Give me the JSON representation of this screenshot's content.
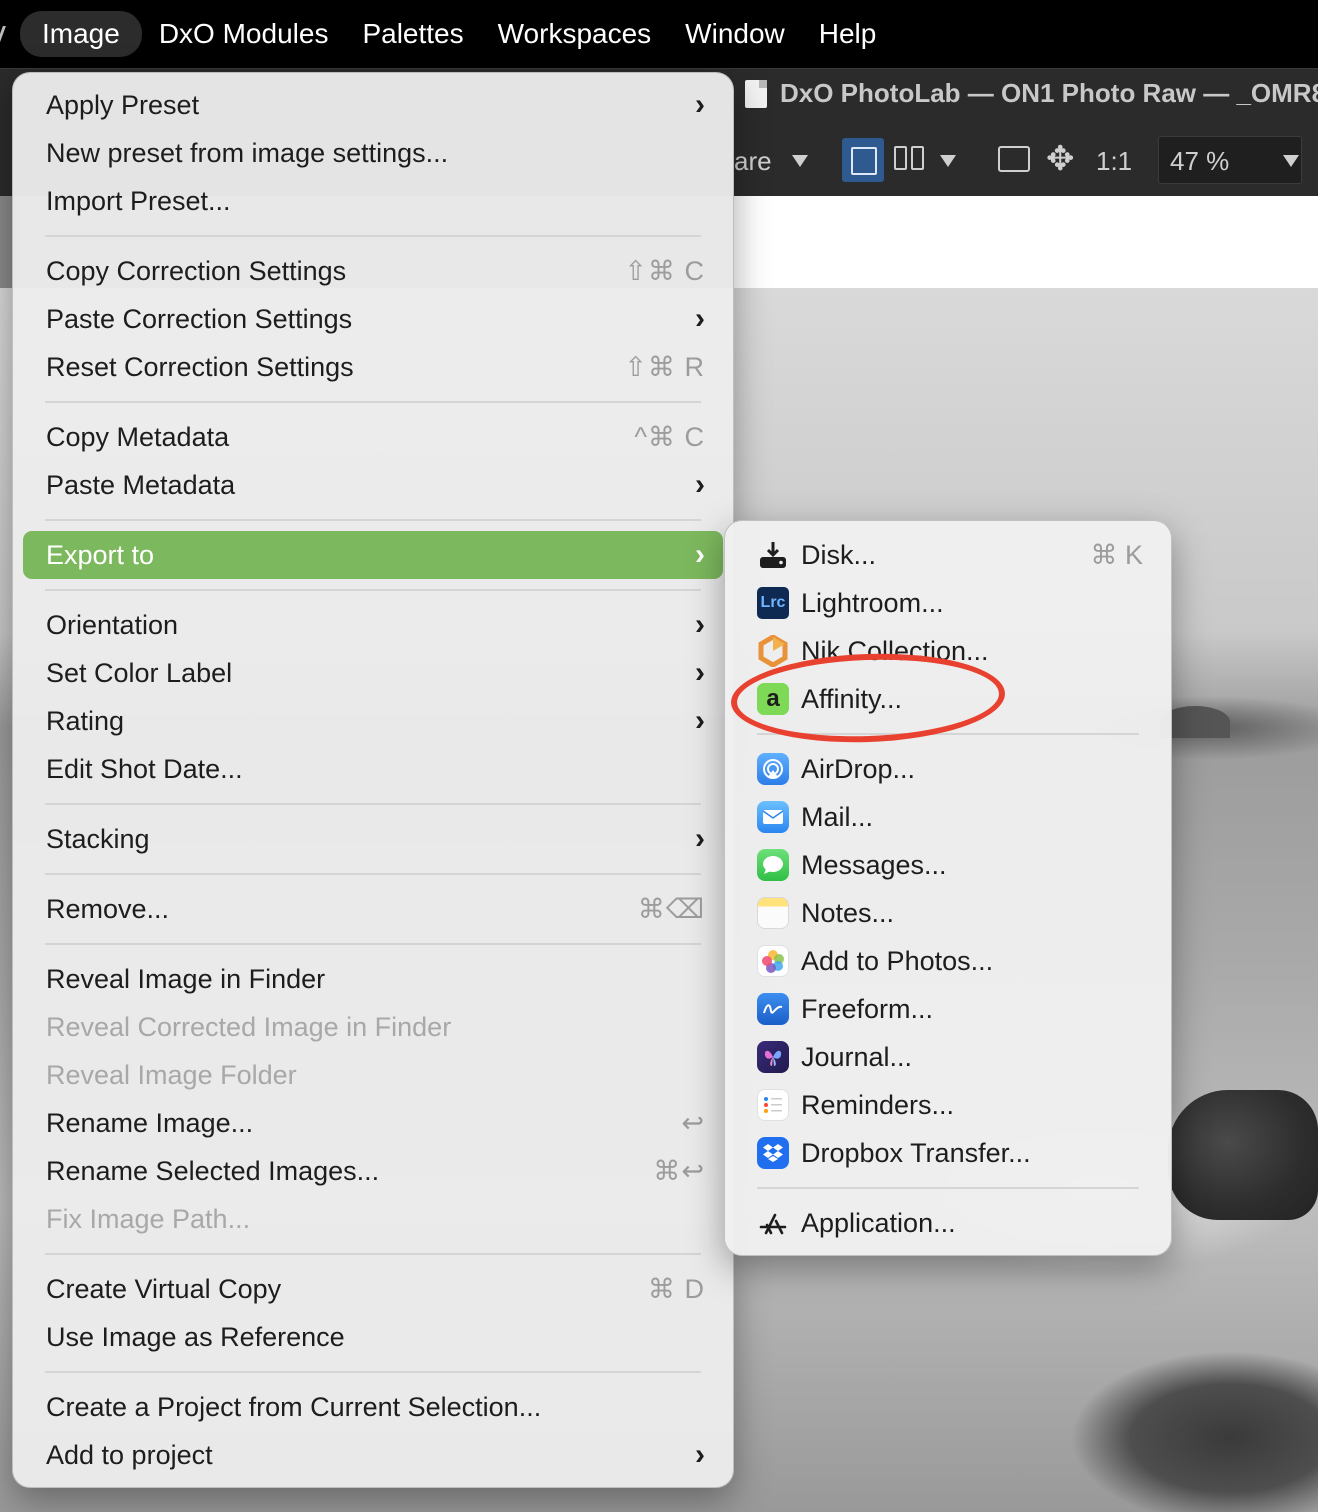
{
  "menubar": {
    "items": [
      {
        "label": "Image",
        "active": true
      },
      {
        "label": "DxO Modules"
      },
      {
        "label": "Palettes"
      },
      {
        "label": "Workspaces"
      },
      {
        "label": "Window"
      },
      {
        "label": "Help"
      }
    ]
  },
  "window": {
    "title": "DxO PhotoLab — ON1 Photo Raw — _OMR8"
  },
  "toolbar": {
    "compare_label": "are",
    "zoom_one_to_one": "1:1",
    "zoom_level": "47 %"
  },
  "menu": {
    "items": [
      {
        "label": "Apply Preset",
        "shortcut": "",
        "submenu": true
      },
      {
        "label": "New preset from image settings...",
        "shortcut": "",
        "submenu": false
      },
      {
        "label": "Import Preset...",
        "shortcut": "",
        "submenu": false
      },
      {
        "label": "Copy Correction Settings",
        "shortcut": "⇧⌘ C",
        "submenu": false
      },
      {
        "label": "Paste Correction Settings",
        "shortcut": "",
        "submenu": true
      },
      {
        "label": "Reset Correction Settings",
        "shortcut": "⇧⌘ R",
        "submenu": false
      },
      {
        "label": "Copy Metadata",
        "shortcut": "^⌘ C",
        "submenu": false
      },
      {
        "label": "Paste Metadata",
        "shortcut": "",
        "submenu": true
      },
      {
        "label": "Export to",
        "shortcut": "",
        "submenu": true,
        "highlighted": true
      },
      {
        "label": "Orientation",
        "shortcut": "",
        "submenu": true
      },
      {
        "label": "Set Color Label",
        "shortcut": "",
        "submenu": true
      },
      {
        "label": "Rating",
        "shortcut": "",
        "submenu": true
      },
      {
        "label": "Edit Shot Date...",
        "shortcut": "",
        "submenu": false
      },
      {
        "label": "Stacking",
        "shortcut": "",
        "submenu": true
      },
      {
        "label": "Remove...",
        "shortcut": "⌘⌫",
        "submenu": false
      },
      {
        "label": "Reveal Image in Finder",
        "shortcut": "",
        "submenu": false
      },
      {
        "label": "Reveal Corrected Image in Finder",
        "shortcut": "",
        "submenu": false,
        "disabled": true
      },
      {
        "label": "Reveal Image Folder",
        "shortcut": "",
        "submenu": false,
        "disabled": true
      },
      {
        "label": "Rename Image...",
        "shortcut": "↩",
        "submenu": false
      },
      {
        "label": "Rename Selected Images...",
        "shortcut": "⌘↩",
        "submenu": false
      },
      {
        "label": "Fix Image Path...",
        "shortcut": "",
        "submenu": false,
        "disabled": true
      },
      {
        "label": "Create Virtual Copy",
        "shortcut": "⌘ D",
        "submenu": false
      },
      {
        "label": "Use Image as Reference",
        "shortcut": "",
        "submenu": false
      },
      {
        "label": "Create a Project from Current Selection...",
        "shortcut": "",
        "submenu": false
      },
      {
        "label": "Add to project",
        "shortcut": "",
        "submenu": true
      }
    ]
  },
  "export_submenu": {
    "items": [
      {
        "label": "Disk...",
        "shortcut": "⌘ K",
        "icon": "disk-export-icon"
      },
      {
        "label": "Lightroom...",
        "shortcut": "",
        "icon": "lightroom-icon",
        "icon_text": "Lrc"
      },
      {
        "label": "Nik Collection...",
        "shortcut": "",
        "icon": "nik-collection-icon"
      },
      {
        "label": "Affinity...",
        "shortcut": "",
        "icon": "affinity-icon",
        "icon_text": "a"
      },
      {
        "label": "AirDrop...",
        "shortcut": "",
        "icon": "airdrop-icon"
      },
      {
        "label": "Mail...",
        "shortcut": "",
        "icon": "mail-icon"
      },
      {
        "label": "Messages...",
        "shortcut": "",
        "icon": "messages-icon"
      },
      {
        "label": "Notes...",
        "shortcut": "",
        "icon": "notes-icon"
      },
      {
        "label": "Add to Photos...",
        "shortcut": "",
        "icon": "photos-icon"
      },
      {
        "label": "Freeform...",
        "shortcut": "",
        "icon": "freeform-icon"
      },
      {
        "label": "Journal...",
        "shortcut": "",
        "icon": "journal-icon"
      },
      {
        "label": "Reminders...",
        "shortcut": "",
        "icon": "reminders-icon"
      },
      {
        "label": "Dropbox Transfer...",
        "shortcut": "",
        "icon": "dropbox-icon"
      },
      {
        "label": "Application...",
        "shortcut": "",
        "icon": "app-store-icon"
      }
    ]
  },
  "colors": {
    "highlight": "#7cb85d",
    "annotation": "#e8412f",
    "active_view_button": "#2f5a8f"
  }
}
